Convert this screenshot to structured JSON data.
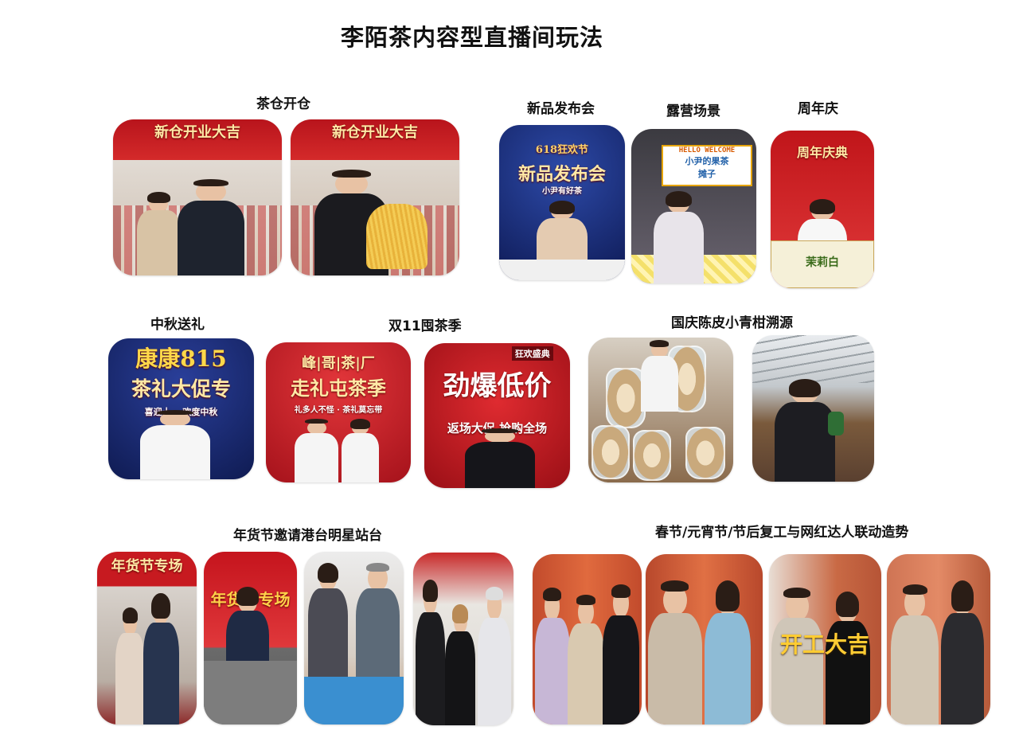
{
  "title": "李陌茶内容型直播间玩法",
  "sections": {
    "tea_warehouse": "茶仓开仓",
    "new_product": "新品发布会",
    "camping": "露营场景",
    "anniversary": "周年庆",
    "mid_autumn": "中秋送礼",
    "double11": "双11囤茶季",
    "national_day": "国庆陈皮小青柑溯源",
    "new_year_goods": "年货节邀请港台明星站台",
    "spring_festival": "春节/元宵节/节后复工与网红达人联动造势"
  },
  "photo_texts": {
    "warehouse_banner": "新仓开业大吉",
    "launch_title": "新品发布会",
    "launch_event": "618狂欢节",
    "launch_sub": "小尹有好茶",
    "camping_board_1": "HELLO WELCOME",
    "camping_board_2": "小尹的果茶",
    "camping_board_3": "摊子",
    "anniv_banner": "周年庆典",
    "anniv_box": "茉莉白",
    "midautumn_title_1": "康康815",
    "midautumn_title_2": "茶礼大促专",
    "midautumn_sub": "喜迎十一 欢度中秋",
    "fengge_title": "峰|哥|茶|厂",
    "fengge_sub": "走礼屯茶季",
    "fengge_tag": "礼多人不怪 · 茶礼莫忘带",
    "burst_title": "劲爆低价",
    "burst_badge": "狂欢盛典",
    "burst_sub": "返场大促 抢购全场",
    "newyear_banner": "年货节专场",
    "start_work": "开工大吉"
  },
  "colors": {
    "title": "#111111",
    "red": "#c8161d",
    "navy": "#1a2a6c",
    "gold": "#ffcc33"
  }
}
